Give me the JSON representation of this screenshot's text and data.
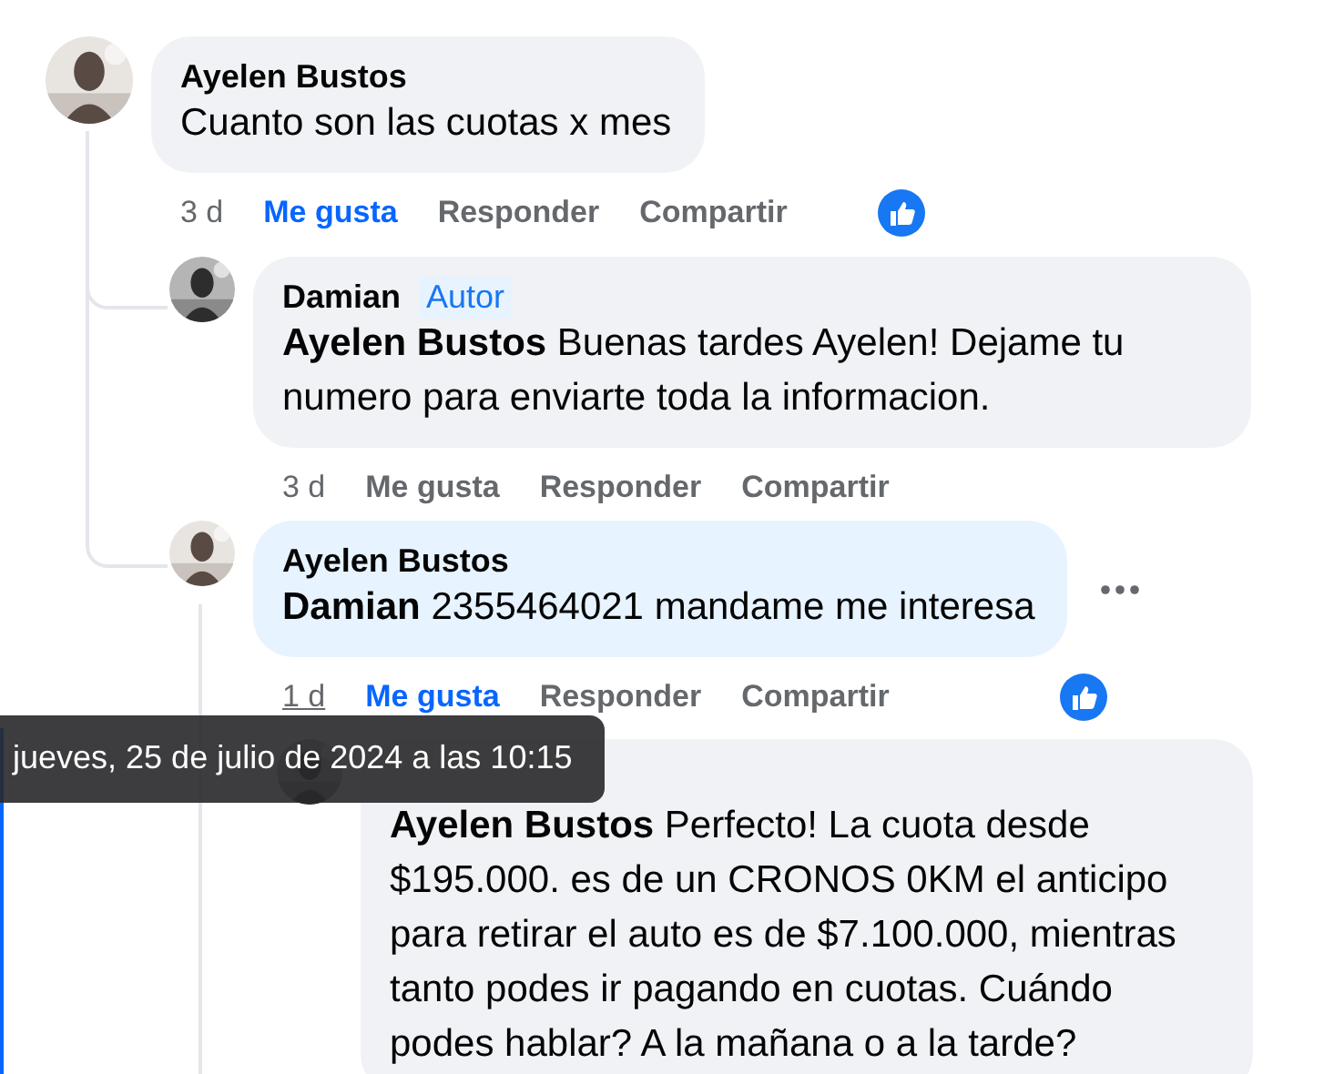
{
  "comments": [
    {
      "author": "Ayelen Bustos",
      "text": "Cuanto son las cuotas x mes",
      "time": "3 d",
      "time_hovered": false,
      "like_label": "Me gusta",
      "liked": true,
      "reply_label": "Responder",
      "share_label": "Compartir",
      "reaction_shown": true,
      "highlighted": false,
      "options_visible": false
    },
    {
      "author": "Damian",
      "badge": "Autor",
      "text": "**Ayelen Bustos** Buenas tardes Ayelen! Dejame tu numero para enviarte toda la informacion.",
      "time": "3 d",
      "time_hovered": false,
      "like_label": "Me gusta",
      "liked": false,
      "reply_label": "Responder",
      "share_label": "Compartir",
      "reaction_shown": false,
      "highlighted": false,
      "options_visible": false
    },
    {
      "author": "Ayelen Bustos",
      "text": "**Damian** 2355464021 mandame me interesa",
      "time": "1 d",
      "time_hovered": true,
      "like_label": "Me gusta",
      "liked": true,
      "reply_label": "Responder",
      "share_label": "Compartir",
      "reaction_shown": true,
      "highlighted": true,
      "options_visible": true
    },
    {
      "text": "**Ayelen Bustos** Perfecto! La cuota desde $195.000. es de un CRONOS 0KM el anticipo para retirar el auto es de $7.100.000, mientras tanto podes ir pagando en cuotas. Cuándo podes hablar? A la mañana o a la tarde?"
    }
  ],
  "tooltip": {
    "text": "jueves, 25 de julio de 2024 a las 10:15"
  }
}
